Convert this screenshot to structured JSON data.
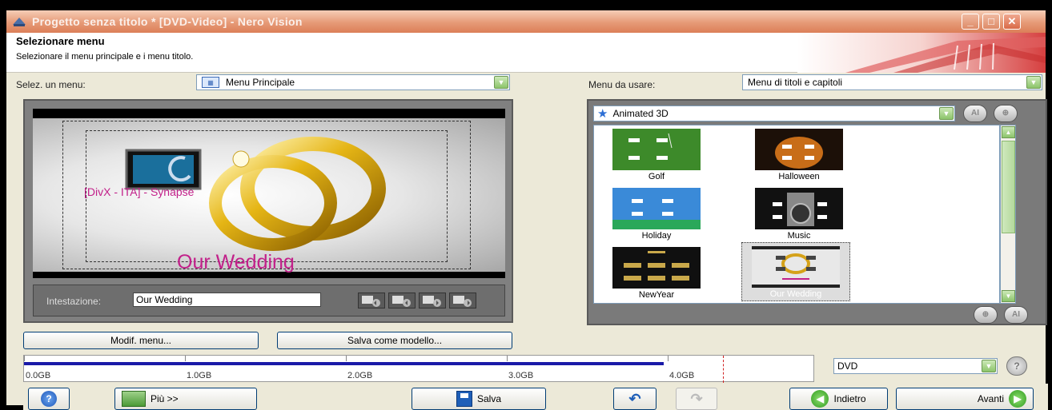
{
  "window": {
    "title": "Progetto senza titolo * [DVD-Video] - Nero Vision"
  },
  "header": {
    "title": "Selezionare menu",
    "subtitle": "Selezionare il menu principale e i menu titolo."
  },
  "left": {
    "select_label": "Selez. un menu:",
    "select_value": "Menu Principale",
    "preview": {
      "overlay_text": "[DivX - ITA] - Synapse",
      "menu_title": "Our Wedding"
    },
    "heading_label": "Intestazione:",
    "heading_value": "Our Wedding",
    "edit_button": "Modif. menu...",
    "save_template_button": "Salva come modello..."
  },
  "right": {
    "use_label": "Menu da usare:",
    "use_value": "Menu di titoli e capitoli",
    "category": "Animated 3D",
    "templates": [
      {
        "name": "Golf"
      },
      {
        "name": "Halloween"
      },
      {
        "name": "Holiday"
      },
      {
        "name": "Music"
      },
      {
        "name": "NewYear"
      },
      {
        "name": "Our Wedding",
        "selected": true
      }
    ]
  },
  "capacity": {
    "labels": [
      "0.0GB",
      "1.0GB",
      "2.0GB",
      "3.0GB",
      "4.0GB"
    ],
    "used_fraction": 0.81,
    "disc_type": "DVD"
  },
  "buttons": {
    "more": "Più >>",
    "save": "Salva",
    "back": "Indietro",
    "next": "Avanti"
  },
  "colors": {
    "title_bar": "#e69a77",
    "capacity_bar": "#1a1aa8",
    "preview_text": "#c2208a"
  }
}
